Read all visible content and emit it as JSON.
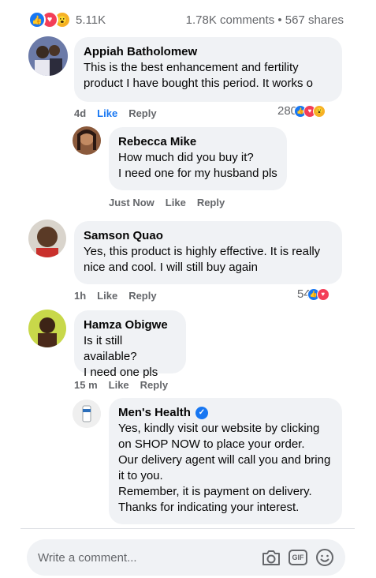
{
  "summary": {
    "reaction_count": "5.11K",
    "stats": "1.78K comments • 567 shares",
    "reaction_icons": [
      "like-icon",
      "love-icon",
      "wow-icon"
    ]
  },
  "comments": [
    {
      "author": "Appiah Batholomew",
      "lines": [
        "This is the best enhancement and fertility",
        "product I have bought this period. It works o"
      ],
      "time": "4d",
      "like": "Like",
      "reply": "Reply",
      "reaction_count": "280"
    },
    {
      "author": "Rebecca Mike",
      "lines": [
        "How much did you buy it?",
        "I need one for my husband pls"
      ],
      "time": "Just Now",
      "like": "Like",
      "reply": "Reply"
    },
    {
      "author": "Samson Quao",
      "lines": [
        "Yes, this product is highly effective. It is really",
        "nice and cool. I will still buy again"
      ],
      "time": "1h",
      "like": "Like",
      "reply": "Reply",
      "reaction_count": "54"
    },
    {
      "author": "Hamza Obigwe",
      "lines": [
        "Is it still available?",
        "I need one pls"
      ],
      "time": "15 m",
      "like": "Like",
      "reply": "Reply"
    },
    {
      "author": "Men's Health",
      "lines": [
        "Yes, kindly visit our website by clicking",
        "on SHOP NOW to place your order.",
        "Our delivery agent will call you and bring",
        "it to you.",
        "Remember, it is payment on delivery.",
        "Thanks for indicating your interest."
      ]
    }
  ],
  "composer": {
    "placeholder": "Write a comment..."
  },
  "colors": {
    "accent": "#1877f2",
    "love": "#f33e58",
    "wow": "#f7b125",
    "bubble": "#f0f2f5"
  }
}
